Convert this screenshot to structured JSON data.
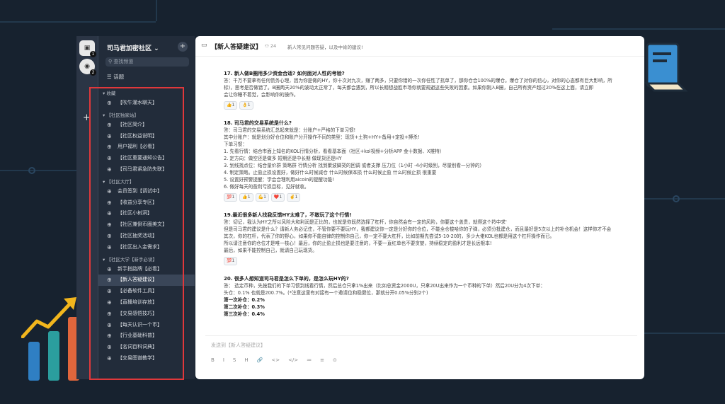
{
  "window": {
    "community_name": "司马君加密社区",
    "search_placeholder": "查找频道",
    "topics_label": "话题"
  },
  "rail": {
    "avatars": [
      {
        "badge": "1"
      },
      {
        "badge": "2"
      }
    ],
    "add_label": "+"
  },
  "sidebar": {
    "sections": [
      {
        "title": "收藏",
        "items": [
          "【吹牛灌水聊天】"
        ]
      },
      {
        "title": "【社区独家站】",
        "items": [
          "【社区简介】",
          "【社区权益说明】",
          "用户福利【必看】",
          "【社区重要通知公告】",
          "【司马君紧急防失联】"
        ]
      },
      {
        "title": "【社区大厅】",
        "items": [
          "会员签到【调试中】",
          "【收益分享专区】",
          "【社区小树洞】",
          "【社区兼倒币圈美文】",
          "【社区抽奖活动】",
          "【社区出入金需求】"
        ]
      },
      {
        "title": "【社区大学【新手必读】",
        "items": [
          "新手指路牌【必看】",
          "【新人答疑建议】",
          "【必备软件工具】",
          "【直播培训存放】",
          "【交易感悟技巧】",
          "【每天认识一个币】",
          "【行业基础科普】",
          "【名词百科词典】",
          "【交易图谱教学】"
        ]
      }
    ],
    "active_item": "【新人答疑建议】"
  },
  "channel": {
    "title": "【新人答疑建议】",
    "member_count": "24",
    "description": "新人常见问题答疑，以及中肯的建议!",
    "composer_placeholder": "发送到【新人答疑建议】"
  },
  "messages": [
    {
      "question": "17. 新人做B圈用多少资金合适? 如何面对人性的考验?",
      "lines": [
        "答：千万不要拿有任何债务心理，因为你是做的HY，你十次对九次，赚了两多，只要你错的一次你任性了抗单了，那你仓合100%的爆仓。爆仓了对你的信心，对你的心态都有巨大影响，所",
        "标)，思考是否做错了。B圈两天20%的波动太正常了，每天都会遇到，所以长期想战胜市场你就要规避这些失败的因素。如果你刚入B圈，自己所有资产超过20%在这上面，请立即",
        "会让你睡不着觉，会影响你的操作。"
      ],
      "reactions": [
        "👍1",
        "👌1"
      ]
    },
    {
      "question": "18. 司马君的交易系统是什么?",
      "lines": [
        "答：司马君的交易系统汇总起来就是：分账户+严格的下单习惯!",
        "其中分账户：就是划分好仓位和账户分开操作不同的类型：现货+土狗+HY+备用+定投+搏杀!",
        "下单习惯：",
        "1. 先看行情：结合市面上知名的KOL行情分析，看看基本面（社区+kol视频+分析APP 金十数据、X推特）",
        "2. 定方向：做空还是做多 短期还是中长期 做现货还是HY",
        "3. 划线找点位：结合量价群 策略群 行情分析 找到聚波脚契的回调 或者支撑 压力位（1小时 -4小时级别，尽量别看一分钟的）",
        "4. 制定策略。止盈止损设置好，做好什么时候减仓 什么时候保本损 什么时候止盈 什么时候止损 很重要",
        "5. 设置好预警提醒：学会合理利用aicoin的提醒功能!",
        "6. 做好每天的盈利亏损目标，见好就收。"
      ],
      "reactions": [
        "💯1",
        "👍1",
        "💪1",
        "❤️1",
        "✌️1"
      ]
    },
    {
      "question": "19.最近很多新人找我反馈HY太难了，不敢玩了这个行情!",
      "lines": [
        "答：切记，我认为HY之所以风险大和利润是正比的，也就是你既然选择了杠杆，你自然会有一定的风险，你要这个盖贵，就得这个羚中求'",
        "但是司马君的建议是什么？请新人务必记住，不管你要不要玩HY，我都建议你一定是分好你的仓位，不能全仓梭哈你的子弹，必须分批建仓，而且最好是5次以上的补仓机会！这样你才不会",
        "其次，你的杠杆，代表了你的野心，如果你不能自律的控制你自己，你一定不要大杠杆，比如前期先尝试5-10-20的，多少大佬KOL也都是用这个杠杆操作而已。",
        "所以请注意你的仓位才是唯一核心！最后，你的止盈止损也是要注意的，不要一直红单也不要贪婪，持续稳定的盈利才是长远根本!",
        "最后，如果不能控制自己，就请自己玩现货。"
      ],
      "reactions": [
        "💯1"
      ]
    },
    {
      "question": "20. 很多人想知道司马君是怎么下单的，是怎么玩HY的?",
      "lines": [
        "答：    选定币种，先按我们的下单习惯到线看行情，然后总仓只拿1%出来（比如总资金2000U，只拿20U出来作为一个币种的下单）然后20U分为4次下单：",
        "头仓：0.1%  也就是200.7%。(*注意这里有对接有一个邀请位和稳健位，那就分开0.05%分别2个)"
      ],
      "bold_lines": [
        "第一次补仓：0.2%",
        "第二次补仓：0.3%",
        "第三次补仓：0.4%"
      ]
    }
  ],
  "toolbar": {
    "tools": [
      "B",
      "I",
      "S",
      "H",
      "🔗",
      "<>",
      "</>",
      "≔",
      "≡",
      "⊙"
    ]
  },
  "colors": {
    "background": "#17222f",
    "highlight_box": "#e0383b",
    "sidebar": "#222c3a"
  }
}
